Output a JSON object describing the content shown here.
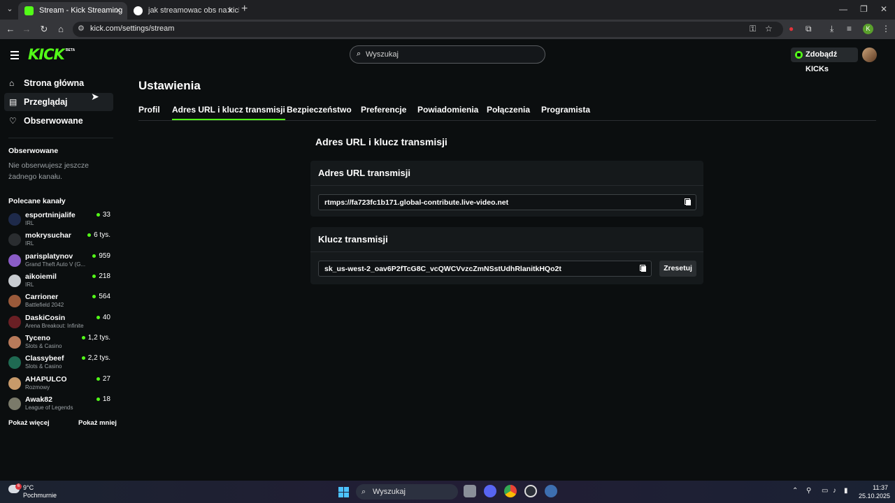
{
  "browser": {
    "tabs": [
      {
        "title": "Stream - Kick Streaming",
        "active": true
      },
      {
        "title": "jak streamowac obs na kick - Sz",
        "active": false
      }
    ],
    "url": "kick.com/settings/stream",
    "profile_initial": "K"
  },
  "header": {
    "logo": "KICK",
    "logo_badge": "BETA",
    "search_placeholder": "Wyszukaj",
    "kicks_button": "Zdobądź KICKs"
  },
  "sidebar": {
    "nav": [
      {
        "label": "Strona główna",
        "icon": "home-icon"
      },
      {
        "label": "Przeglądaj",
        "icon": "browse-icon"
      },
      {
        "label": "Obserwowane",
        "icon": "heart-icon"
      }
    ],
    "followed_heading": "Obserwowane",
    "followed_empty": "Nie obserwujesz jeszcze żadnego kanału.",
    "recommended_heading": "Polecane kanały",
    "channels": [
      {
        "name": "esportninjalife",
        "category": "IRL",
        "viewers": "33",
        "color": "#1e2a4a"
      },
      {
        "name": "mokrysuchar",
        "category": "IRL",
        "viewers": "6 tys.",
        "color": "#2a2d30"
      },
      {
        "name": "parisplatynov",
        "category": "Grand Theft Auto V (G...",
        "viewers": "959",
        "color": "#8a5cc7"
      },
      {
        "name": "aikoiemil",
        "category": "IRL",
        "viewers": "218",
        "color": "#c8ccd0"
      },
      {
        "name": "Carrioner",
        "category": "Battlefield 2042",
        "viewers": "564",
        "color": "#9a5a3a"
      },
      {
        "name": "DaskiCosin",
        "category": "Arena Breakout: Infinite",
        "viewers": "40",
        "color": "#6a1f24"
      },
      {
        "name": "Tyceno",
        "category": "Slots & Casino",
        "viewers": "1,2 tys.",
        "color": "#b87a5a"
      },
      {
        "name": "Classybeef",
        "category": "Slots & Casino",
        "viewers": "2,2 tys.",
        "color": "#1f6a52"
      },
      {
        "name": "AHAPULCO",
        "category": "Rozmowy",
        "viewers": "27",
        "color": "#c89a6a"
      },
      {
        "name": "Awak82",
        "category": "League of Legends",
        "viewers": "18",
        "color": "#7a7a6a"
      }
    ],
    "show_more": "Pokaż więcej",
    "show_less": "Pokaż mniej"
  },
  "main": {
    "title": "Ustawienia",
    "tabs": [
      "Profil",
      "Adres URL i klucz transmisji",
      "Bezpieczeństwo",
      "Preferencje",
      "Powiadomienia",
      "Połączenia",
      "Programista"
    ],
    "active_tab": "Adres URL i klucz transmisji",
    "section_title": "Adres URL i klucz transmisji",
    "url_card": {
      "title": "Adres URL transmisji",
      "value": "rtmps://fa723fc1b171.global-contribute.live-video.net"
    },
    "key_card": {
      "title": "Klucz transmisji",
      "value": "sk_us-west-2_oav6P2fTcG8C_vcQWCVvzcZmNSstUdhRlanitkHQo2t",
      "reset_button": "Zresetuj"
    }
  },
  "taskbar": {
    "weather_temp": "9°C",
    "weather_desc": "Pochmurnie",
    "weather_badge": "6",
    "search_label": "Wyszukaj",
    "time": "11:37",
    "date": "25.10.2025"
  }
}
